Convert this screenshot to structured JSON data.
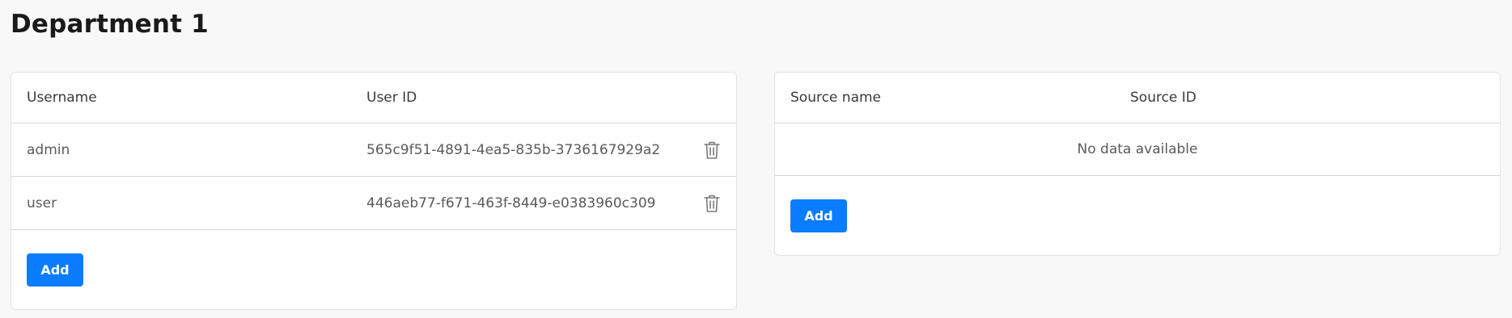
{
  "page": {
    "title": "Department 1"
  },
  "users_table": {
    "columns": [
      "Username",
      "User ID"
    ],
    "rows": [
      {
        "username": "admin",
        "user_id": "565c9f51-4891-4ea5-835b-3736167929a2"
      },
      {
        "username": "user",
        "user_id": "446aeb77-f671-463f-8449-e0383960c309"
      }
    ],
    "row_action_icon": "trash-icon",
    "add_label": "Add"
  },
  "sources_table": {
    "columns": [
      "Source name",
      "Source ID"
    ],
    "empty_text": "No data available",
    "add_label": "Add"
  },
  "colors": {
    "accent": "#0a7cff",
    "background": "#f8f8f8",
    "panel": "#ffffff"
  }
}
